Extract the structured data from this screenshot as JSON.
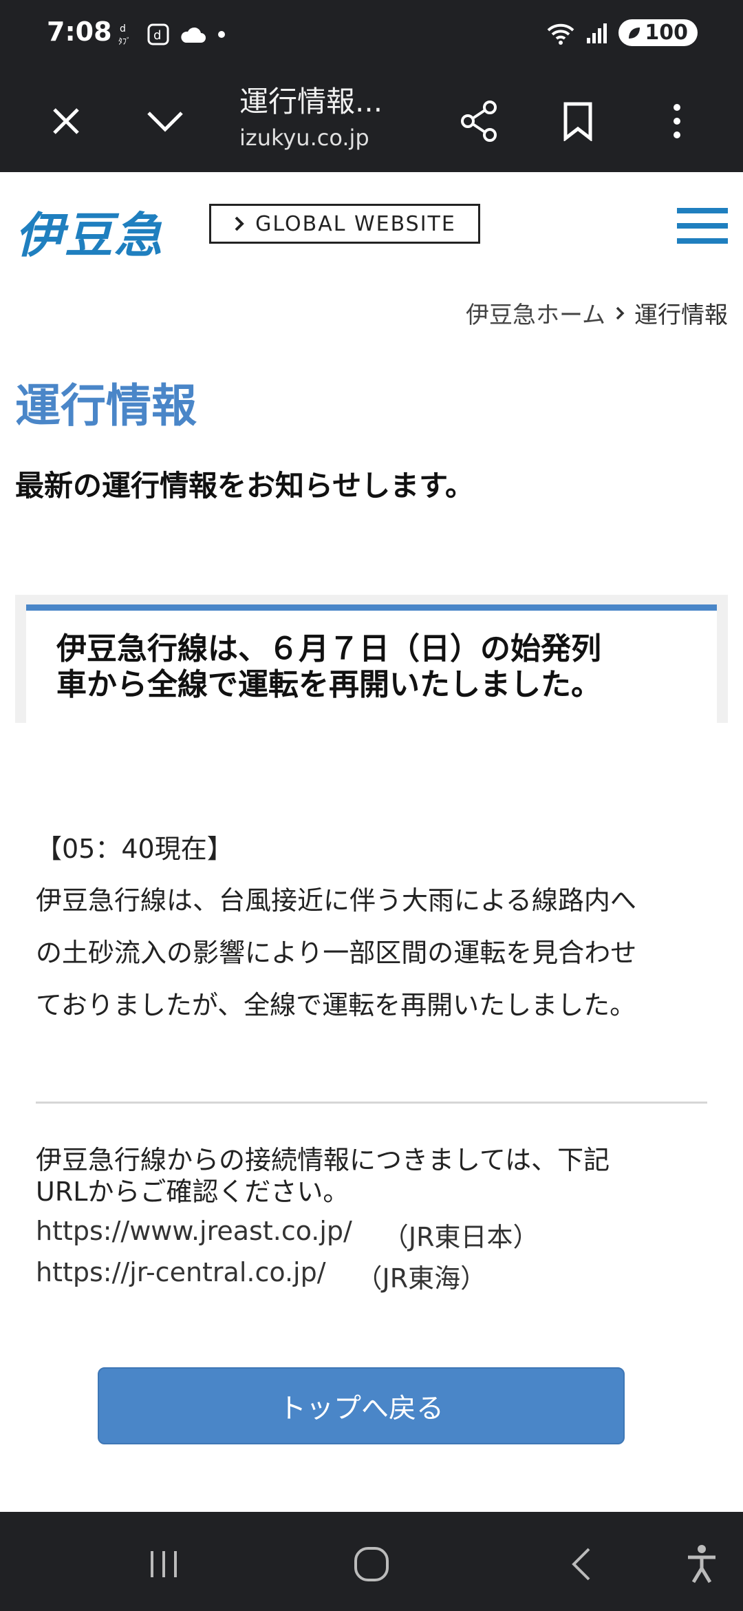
{
  "status_bar": {
    "time": "7:08",
    "battery": "100",
    "icons_left": [
      "dtv-icon",
      "docomo-icon",
      "cloud-icon",
      "dot-icon"
    ],
    "icons_right": [
      "wifi-icon",
      "signal-icon",
      "battery-icon"
    ]
  },
  "browser": {
    "title": "運行情報...",
    "domain": "izukyu.co.jp"
  },
  "site": {
    "logo_text": "伊豆急",
    "global_button": "GLOBAL WEBSITE",
    "brand_color": "#1f7fbf"
  },
  "breadcrumb": {
    "home": "伊豆急ホーム",
    "current": "運行情報"
  },
  "page": {
    "title": "運行情報",
    "lead": "最新の運行情報をお知らせします。",
    "accent_color": "#4a86c8"
  },
  "notice": {
    "line1": "伊豆急行線は、６月７日（日）の始発列",
    "line2": "車から全線で運転を再開いたしました。"
  },
  "update": {
    "time_label": "【05：40現在】",
    "line1": "伊豆急行線は、台風接近に伴う大雨による線路内へ",
    "line2": "の土砂流入の影響により一部区間の運転を見合わせ",
    "line3": "ておりましたが、全線で運転を再開いたしました。"
  },
  "connections": {
    "text_line1": "伊豆急行線からの接続情報につきましては、下記",
    "text_line2": "URLからご確認ください。",
    "links": [
      {
        "url": "https://www.jreast.co.jp/",
        "label": "（JR東日本）"
      },
      {
        "url": "https://jr-central.co.jp/",
        "label": "（JR東海）"
      }
    ]
  },
  "back_to_top": "トップへ戻る"
}
